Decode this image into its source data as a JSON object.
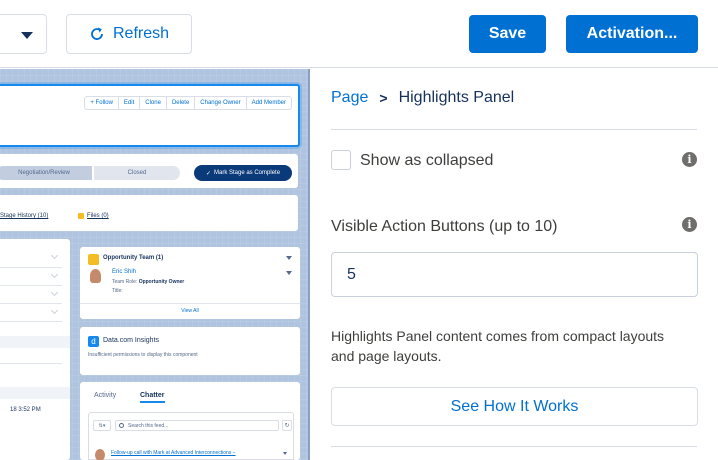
{
  "toolbar": {
    "refresh_label": "Refresh",
    "save_label": "Save",
    "activation_label": "Activation..."
  },
  "canvas": {
    "highlights_actions": [
      "+ Follow",
      "Edit",
      "Clone",
      "Delete",
      "Change Owner",
      "Add Member"
    ],
    "path_stages": [
      "Negotiation/Review",
      "Closed"
    ],
    "mark_complete_label": "Mark Stage as Complete",
    "related_links": [
      "Stage History (10)",
      "Files (0)"
    ],
    "detail_timestamp": "18 3:52 PM",
    "team": {
      "title": "Opportunity Team (1)",
      "member_name": "Eric Shih",
      "role_label": "Team Role:",
      "role_value": "Opportunity Owner",
      "title_label": "Title:",
      "view_all": "View All"
    },
    "insights": {
      "icon_letter": "d",
      "title": "Data.com Insights",
      "message": "Insufficient permissions to display this component"
    },
    "feed": {
      "tabs": [
        "Activity",
        "Chatter"
      ],
      "search_placeholder": "Search this feed...",
      "item_text": "Follow-up call with Mark at Advanced Interconnections –"
    }
  },
  "panel": {
    "breadcrumb_root": "Page",
    "breadcrumb_separator": ">",
    "breadcrumb_current": "Highlights Panel",
    "show_collapsed_label": "Show as collapsed",
    "show_collapsed_checked": false,
    "visible_actions_label": "Visible Action Buttons (up to 10)",
    "visible_actions_value": "5",
    "help_text": "Highlights Panel content comes from compact layouts and page layouts.",
    "see_how_label": "See How It Works"
  },
  "colors": {
    "brand": "#0070d2",
    "canvas_bg": "#b0c4df",
    "selection": "#1589ee"
  },
  "icons": [
    "chevron-down-icon",
    "refresh-icon",
    "info-icon",
    "search-icon",
    "check-icon",
    "avatar"
  ]
}
